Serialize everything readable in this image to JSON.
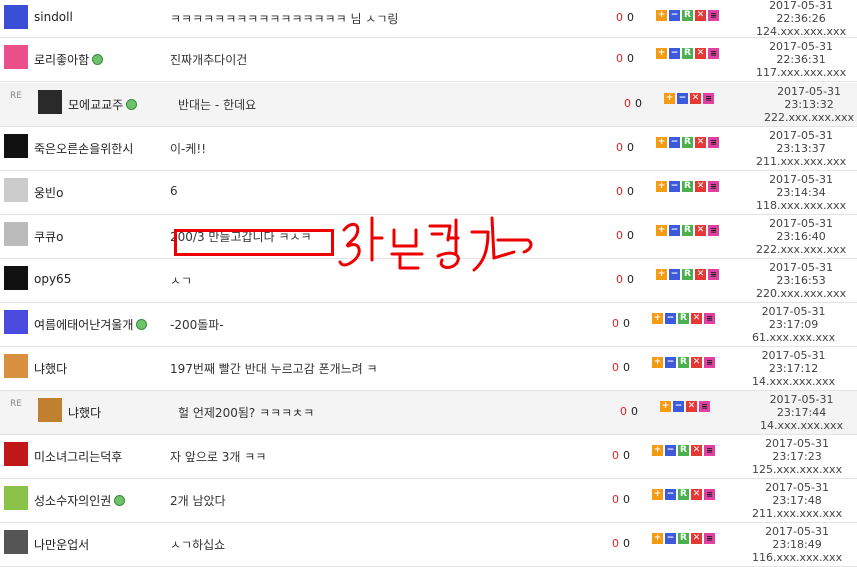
{
  "annotation": {
    "handwriting": "3분 경과"
  },
  "rows": [
    {
      "nick": "sindoll",
      "online": false,
      "reply": false,
      "msg": "ㅋㅋㅋㅋㅋㅋㅋㅋㅋㅋㅋㅋㅋㅋㅋㅋ 님 ㅅㄱ링",
      "up": "0",
      "down": "0",
      "date": "2017-05-31",
      "time": "22:36:26",
      "ip": "124.xxx.xxx.xxx"
    },
    {
      "nick": "로리좋아함",
      "online": true,
      "reply": false,
      "msg": "진짜개추다이건",
      "up": "0",
      "down": "0",
      "date": "2017-05-31",
      "time": "22:36:31",
      "ip": "117.xxx.xxx.xxx"
    },
    {
      "nick": "모에교교주",
      "online": true,
      "reply": true,
      "re_label": "RE",
      "msg": "반대는 - 한데요",
      "up": "0",
      "down": "0",
      "date": "2017-05-31",
      "time": "23:13:32",
      "ip": "222.xxx.xxx.xxx"
    },
    {
      "nick": "죽은오른손을위한시",
      "online": false,
      "reply": false,
      "msg": "이-케!!",
      "up": "0",
      "down": "0",
      "date": "2017-05-31",
      "time": "23:13:37",
      "ip": "211.xxx.xxx.xxx"
    },
    {
      "nick": "웅빈o",
      "online": false,
      "reply": false,
      "msg": "6",
      "up": "0",
      "down": "0",
      "date": "2017-05-31",
      "time": "23:14:34",
      "ip": "118.xxx.xxx.xxx"
    },
    {
      "nick": "쿠큐o",
      "online": false,
      "reply": false,
      "msg": "200/3 만들고갑니다 ㅋㅅㅋ",
      "up": "0",
      "down": "0",
      "date": "2017-05-31",
      "time": "23:16:40",
      "ip": "222.xxx.xxx.xxx"
    },
    {
      "nick": "opy65",
      "online": false,
      "reply": false,
      "msg": "ㅅㄱ",
      "up": "0",
      "down": "0",
      "date": "2017-05-31",
      "time": "23:16:53",
      "ip": "220.xxx.xxx.xxx"
    },
    {
      "nick": "여름에태어난겨울개",
      "online": true,
      "reply": false,
      "msg": "-200돌파-",
      "up": "0",
      "down": "0",
      "date": "2017-05-31",
      "time": "23:17:09",
      "ip": "61.xxx.xxx.xxx"
    },
    {
      "nick": "냐했다",
      "online": false,
      "reply": false,
      "msg": "197번째 빨간 반대 누르고감 폰개느려 ㅋ",
      "up": "0",
      "down": "0",
      "date": "2017-05-31",
      "time": "23:17:12",
      "ip": "14.xxx.xxx.xxx"
    },
    {
      "nick": "냐했다",
      "online": false,
      "reply": true,
      "re_label": "RE",
      "msg": "헐 언제200됨? ㅋㅋㅋㅊㅋ",
      "up": "0",
      "down": "0",
      "date": "2017-05-31",
      "time": "23:17:44",
      "ip": "14.xxx.xxx.xxx"
    },
    {
      "nick": "미소녀그리는덕후",
      "online": false,
      "reply": false,
      "msg": "자 앞으로 3개 ㅋㅋ",
      "up": "0",
      "down": "0",
      "date": "2017-05-31",
      "time": "23:17:23",
      "ip": "125.xxx.xxx.xxx"
    },
    {
      "nick": "성소수자의인권",
      "online": true,
      "reply": false,
      "msg": "2개 남았다",
      "up": "0",
      "down": "0",
      "date": "2017-05-31",
      "time": "23:17:48",
      "ip": "211.xxx.xxx.xxx"
    },
    {
      "nick": "나만운업서",
      "online": false,
      "reply": false,
      "msg": "ㅅㄱ하십쇼",
      "up": "0",
      "down": "0",
      "date": "2017-05-31",
      "time": "23:18:49",
      "ip": "116.xxx.xxx.xxx"
    }
  ],
  "buttons": {
    "plus": "+",
    "minus": "−",
    "r": "R",
    "x": "✕",
    "p": "≡"
  }
}
